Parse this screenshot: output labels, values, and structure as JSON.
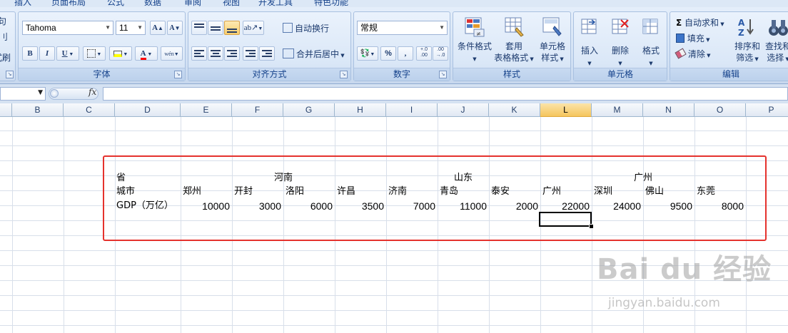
{
  "ribbon": {
    "tabs": [
      "插入",
      "页面布局",
      "公式",
      "数据",
      "审阅",
      "视图",
      "开发工具",
      "特色功能"
    ],
    "left_edge": {
      "top": "句",
      "middle": "刂",
      "bottom": "式刷"
    },
    "font": {
      "group_label": "字体",
      "font_name": "Tahoma",
      "font_size": "11",
      "grow_label": "A",
      "shrink_label": "A",
      "bold": "B",
      "italic": "I",
      "underline": "U",
      "font_color_label": "A",
      "phonetic_label": "wén",
      "colors": {
        "highlight": "#ffff00",
        "font_color": "#ff0000"
      }
    },
    "alignment": {
      "group_label": "对齐方式",
      "wrap_text": "自动换行",
      "merge_center": "合并后居中"
    },
    "number": {
      "group_label": "数字",
      "format": "常规",
      "percent": "%",
      "comma": ",",
      "inc_decimal": "+.0\n.00",
      "dec_decimal": ".00\n→.0"
    },
    "styles": {
      "group_label": "样式",
      "conditional": "条件格式",
      "as_table_1": "套用",
      "as_table_2": "表格格式",
      "cell_styles_1": "单元格",
      "cell_styles_2": "样式"
    },
    "cells": {
      "group_label": "单元格",
      "insert": "插入",
      "delete": "删除",
      "format": "格式"
    },
    "editing": {
      "group_label": "编辑",
      "autosum": "自动求和",
      "fill": "填充",
      "clear": "清除",
      "sort_1": "排序和",
      "sort_2": "筛选",
      "find_1": "查找和",
      "find_2": "选择"
    }
  },
  "formula_bar": {
    "fx": "fx",
    "name_box": "",
    "formula": ""
  },
  "grid": {
    "columns": [
      "B",
      "C",
      "D",
      "E",
      "F",
      "G",
      "H",
      "I",
      "J",
      "K",
      "L",
      "M",
      "N",
      "O",
      "P"
    ],
    "active_column": "L",
    "rows": {
      "province": {
        "label": "省",
        "values": [
          "河南",
          "山东",
          "广州"
        ]
      },
      "city": {
        "label": "城市",
        "values": [
          "郑州",
          "开封",
          "洛阳",
          "许昌",
          "济南",
          "青岛",
          "泰安",
          "广州",
          "深圳",
          "佛山",
          "东莞"
        ]
      },
      "gdp": {
        "label": "GDP（万亿）",
        "values": [
          "10000",
          "3000",
          "6000",
          "3500",
          "7000",
          "11000",
          "2000",
          "22000",
          "24000",
          "9500",
          "8000"
        ]
      }
    }
  },
  "watermark": {
    "main": "Bai du 经验",
    "sub": "jingyan.baidu.com"
  },
  "accent": {
    "highlight_box": "#e5322d",
    "active_header": "#f5c55d"
  }
}
